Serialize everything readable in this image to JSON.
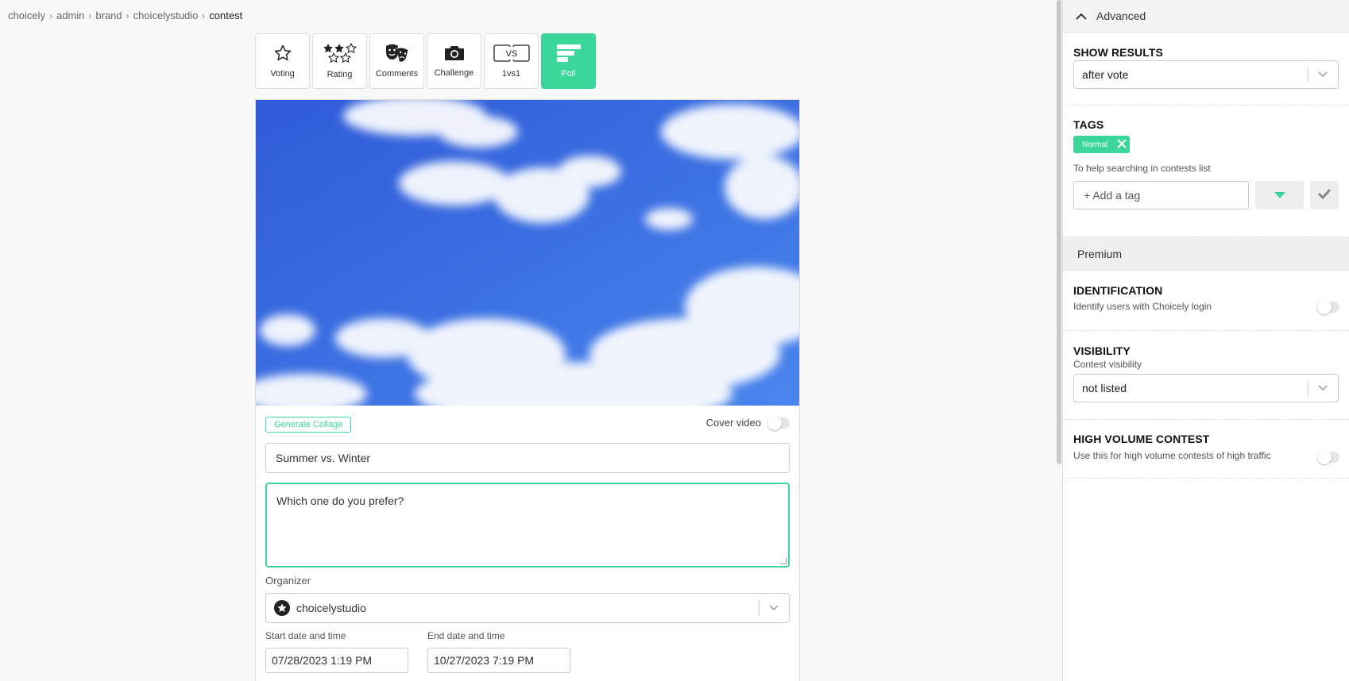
{
  "breadcrumb": [
    "choicely",
    "admin",
    "brand",
    "choicelystudio",
    "contest"
  ],
  "types": [
    {
      "label": "Voting",
      "icon": "star-icon",
      "active": false
    },
    {
      "label": "Rating",
      "icon": "stars-rating-icon",
      "active": false
    },
    {
      "label": "Comments",
      "icon": "theater-masks-icon",
      "active": false
    },
    {
      "label": "Challenge",
      "icon": "camera-icon",
      "active": false
    },
    {
      "label": "1vs1",
      "icon": "vs-icon",
      "active": false
    },
    {
      "label": "Poll",
      "icon": "poll-bars-icon",
      "active": true
    }
  ],
  "vs_text": "VS",
  "accent_color": "#3bd69a",
  "form": {
    "generate_collage": "Generate Collage",
    "cover_video_label": "Cover video",
    "title_value": "Summer vs. Winter",
    "description_value": "Which one do you prefer?",
    "organizer_label": "Organizer",
    "organizer_value": "choicelystudio",
    "start_label": "Start date and time",
    "start_value": "07/28/2023 1:19 PM",
    "end_label": "End date and time",
    "end_value": "10/27/2023 7:19 PM"
  },
  "panel": {
    "advanced_label": "Advanced",
    "show_results_heading": "SHOW RESULTS",
    "show_results_value": "after vote",
    "tags_heading": "TAGS",
    "tag_chip": "Normal",
    "tags_help": "To help searching in contests list",
    "tag_placeholder": "+ Add a tag",
    "premium_label": "Premium",
    "identification_heading": "IDENTIFICATION",
    "identification_sub": "Identify users with Choicely login",
    "visibility_heading": "VISIBILITY",
    "visibility_sub": "Contest visibility",
    "visibility_value": "not listed",
    "high_volume_heading": "HIGH VOLUME CONTEST",
    "high_volume_sub": "Use this for high volume contests of high traffic"
  }
}
